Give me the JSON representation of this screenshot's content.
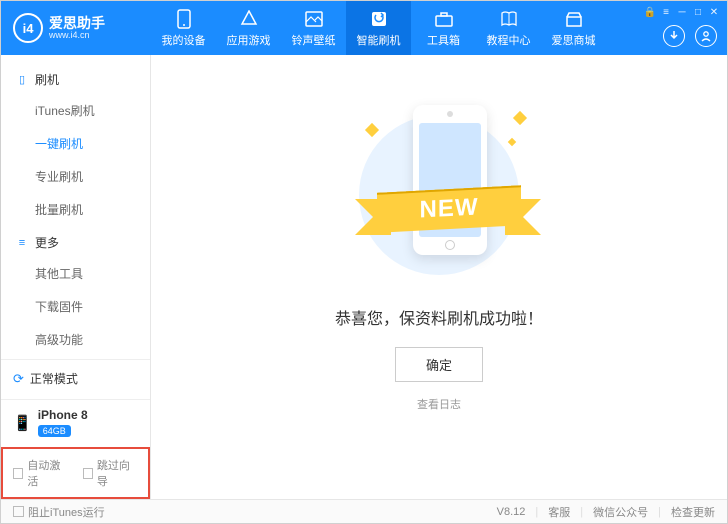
{
  "logo": {
    "mark": "i4",
    "title": "爱思助手",
    "url": "www.i4.cn"
  },
  "tabs": [
    {
      "label": "我的设备"
    },
    {
      "label": "应用游戏"
    },
    {
      "label": "铃声壁纸"
    },
    {
      "label": "智能刷机"
    },
    {
      "label": "工具箱"
    },
    {
      "label": "教程中心"
    },
    {
      "label": "爱思商城"
    }
  ],
  "activeTabIndex": 3,
  "sidebar": {
    "groups": [
      {
        "label": "刷机",
        "items": [
          "iTunes刷机",
          "一键刷机",
          "专业刷机",
          "批量刷机"
        ],
        "activeIndex": 1
      },
      {
        "label": "更多",
        "items": [
          "其他工具",
          "下载固件",
          "高级功能"
        ]
      }
    ],
    "mode": "正常模式",
    "device": {
      "name": "iPhone 8",
      "storage": "64GB"
    },
    "checks": [
      "自动激活",
      "跳过向导"
    ]
  },
  "main": {
    "ribbon": "NEW",
    "success": "恭喜您，保资料刷机成功啦！",
    "ok": "确定",
    "log": "查看日志"
  },
  "footer": {
    "blockItunes": "阻止iTunes运行",
    "version": "V8.12",
    "links": [
      "客服",
      "微信公众号",
      "检查更新"
    ]
  }
}
